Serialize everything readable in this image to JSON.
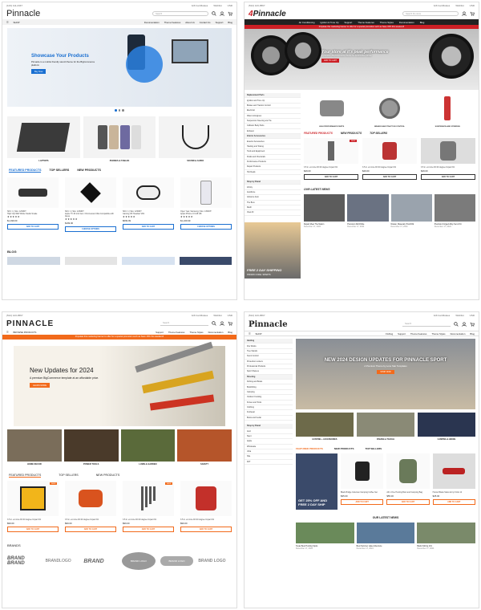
{
  "p1": {
    "util_left": "(123) 111-2347",
    "util_right": [
      "Gift Certificates",
      "Wishlist",
      "USD"
    ],
    "logo": "Pinnacle",
    "search_placeholder": "Search",
    "nav": {
      "shop": "SHOP",
      "links": [
        "Documentation",
        "Theme Features",
        "About Us",
        "Contact Us",
        "Support",
        "Blog"
      ]
    },
    "hero": {
      "title": "Showcase Your Products",
      "text": "Pinnacle is a mobile friendly stencil theme for the BigCommerce platform",
      "button": "Buy Now"
    },
    "cats": [
      "LAPTOPS",
      "PHONES & TABLES",
      "SOUND & AUDIO"
    ],
    "tabs": [
      "FEATURED PRODUCTS",
      "TOP SELLERS",
      "NEW PRODUCTS"
    ],
    "products": [
      {
        "meta": "SKU: 1 | Sku: 12S0NT",
        "name": "High Clip Wild Whole Studio Snake",
        "price": "$1,499.00",
        "btn": "ADD TO CART"
      },
      {
        "meta": "SKU: 1 | Sku: 12S0NT",
        "name": "Apple TV 4K 2nd Gen. Chromecast Ultra Compatible with Alexa",
        "price": "$199.00",
        "btn": "CHOOSE OPTIONS"
      },
      {
        "meta": "SKU: 1 | Sku: 12S0NT",
        "name": "Gaming VR Headset VR1",
        "price": "$699.99",
        "btn": "ADD TO CART"
      },
      {
        "meta": "Open Year, Samsung | Sku: 13S0NT",
        "name": "Apple iPhone 13 128 GB",
        "price": "$1,229.99",
        "btn": "CHOOSE OPTIONS"
      }
    ],
    "blog": "BLOG"
  },
  "p2": {
    "util_left": "(512) 123-0567",
    "util_right": [
      "Gift Certificates",
      "Wishlist",
      "USD"
    ],
    "logo": "Pinnacle",
    "search_placeholder": "Search the store",
    "nav": [
      "Air Conditioning",
      "Ignition & Tune Up",
      "Support",
      "Theme Features",
      "Theme Styles",
      "Documentation",
      "Blog"
    ],
    "redbar": "Populate this marketing banner to offer for a special promotion such as Save 15% this weekend!",
    "hero": {
      "title": "Your store at it's peak performance",
      "text": "A premium BigCommerce theme for Automotive stores",
      "button": "ADD TO CART"
    },
    "sidebar": [
      "Replacement Parts",
      "Ignition and Tune Up",
      "Brakes and Traction Control",
      "Electrical",
      "Filters & Engines",
      "Suspension Steering and Tie",
      "Collision Body Parts",
      "Exhaust",
      "Interior Accessories",
      "Exterior Accessories",
      "Hauling and Towing",
      "Tools and Equipment",
      "Fluids and Chemicals",
      "Performance Products",
      "Repair Products",
      "Hot Deals"
    ],
    "shopbrand": [
      "Shop by Brand",
      "Infinity",
      "AutoZone",
      "Advance Auto",
      "The Brux",
      "Merill",
      "View All"
    ],
    "cats": [
      "HIGH PERFORMANCE PARTS",
      "BRAKES AND TRACTION CONTROL",
      "SUSPENSION AND STEERING"
    ],
    "tabs": [
      "FEATURED PRODUCTS",
      "NEW PRODUCTS",
      "TOP SELLERS"
    ],
    "products": [
      {
        "name": "3.5 in. ext Line Fill 40 degree Impact Kit",
        "price": "$49.00",
        "btn": "ADD TO CART"
      },
      {
        "name": "3.5 in. ext Line Fill 40 degree Impact Kit",
        "price": "$49.00",
        "btn": "ADD TO CART"
      },
      {
        "name": "3.5 in. ext Line Fill 40 degree Impact Kit",
        "price": "$49.00",
        "btn": "ADD TO CART"
      }
    ],
    "promo": {
      "title": "FREE 2 DAY SHIPPING",
      "code": "PROMO CODE: SPARTS"
    },
    "news_title": "OUR LATEST NEWS",
    "news": [
      {
        "t": "Repair Meet The Nation",
        "d": "December 17, 2024"
      },
      {
        "t": "Premium 2024 Ride",
        "d": "December 17, 2024"
      },
      {
        "t": "Nissan, Maserati, Pirelli Rd",
        "d": "December 17, 2024"
      },
      {
        "t": "Precision Forged Alloy Set & Kit",
        "d": "December 17, 2024"
      }
    ]
  },
  "p3": {
    "util_left": "(512) 123-0567",
    "util_right": [
      "Gift Certificates",
      "Wishlist",
      "USD"
    ],
    "logo": "PINNACLE",
    "search_placeholder": "Search",
    "nav": {
      "shop": "BROWSE PRODUCTS",
      "links": [
        "Support",
        "Theme Features",
        "Theme Styles",
        "Documentation",
        "Blog"
      ]
    },
    "orangebar": "Populate this marketing banner to offer for a special promotion such as Save 15% this weekend!",
    "hero": {
      "title": "New Updates for 2024",
      "text": "A premium BigCommerce template at an affordable price.",
      "button": "LEARN MORE"
    },
    "cats": [
      "HOME DECOR",
      "POWER TOOLS",
      "LAWN & GARDEN",
      "SAFETY"
    ],
    "tabs": [
      "FEATURED PRODUCTS",
      "TOP SELLERS",
      "NEW PRODUCTS"
    ],
    "products": [
      {
        "name": "3.5 in. ext Line Fill 40 degree Impact Kit",
        "price": "$99.00",
        "btn": "ADD TO CART"
      },
      {
        "name": "3.5 in. ext Line Fill 40 degree Impact Kit",
        "price": "$99.00",
        "btn": "ADD TO CART"
      },
      {
        "name": "3.5 in. ext Line Fill 40 degree Impact Kit",
        "price": "$99.00",
        "btn": "ADD TO CART"
      },
      {
        "name": "3.5 in. ext Line Fill 40 degree Impact Kit",
        "price": "$99.00",
        "btn": "ADD TO CART"
      }
    ],
    "brands_title": "BRANDS",
    "brands": [
      "BRAND BRAND",
      "BRANDLOGO",
      "BRAND",
      "BRAND LOGO",
      "BRAND LOGO",
      "BRAND LOGO"
    ]
  },
  "p4": {
    "util_left": "(512) 123-0567",
    "util_right": [
      "Gift Certificates",
      "Wishlist",
      "USD"
    ],
    "logo": "Pinnacle",
    "search_placeholder": "Search",
    "nav": {
      "shop": "SHOP",
      "links": [
        "Fishing",
        "Support",
        "Theme Features",
        "Theme Styles",
        "Documentation",
        "Blog"
      ]
    },
    "sidebar": [
      "Hunting",
      "Fire Works",
      "Tree Stands",
      "Scent Control",
      "Protection Lockers",
      "Professional Products",
      "Sport Shelves"
    ],
    "sidebar2": [
      "Shooting",
      "Fishing and Boats",
      "Bowfishing",
      "Camping",
      "Outdoor Cooking",
      "Knives and Tools",
      "Clothing",
      "Footwear",
      "Boots and Cedar"
    ],
    "shopbrand": [
      "Shop by Brand",
      "Avid",
      "Stent",
      "Apple",
      "Wholesale",
      "Ultra",
      "Nite",
      "KFT"
    ],
    "hero": {
      "title": "NEW 2024 DESIGN UPDATES FOR PINNACLE SPORT",
      "text": "A Premium Theme by Lone Star Templates",
      "button": "SHOP NOW"
    },
    "cats": [
      "HUNTING + ACCESSORIES",
      "FISHING & TACKLE",
      "CAMPING & HIKING"
    ],
    "tabs": [
      "FEATURED PRODUCTS",
      "NEW PRODUCTS",
      "TOP SELLERS"
    ],
    "promo": {
      "title": "GET 25% OFF AND FREE 2 DAY SHIP"
    },
    "products": [
      {
        "name": "Black Bridge Coleman Camping Coffee Set",
        "price": "$35.00",
        "btn": "ADD TO CART"
      },
      {
        "name": "All in One Hunting Boot and Camping Bag",
        "price": "$55.00",
        "btn": "ADD TO CART"
      },
      {
        "name": "Hunter Blade Swiss Army Knife 12",
        "price": "$25.00",
        "btn": "ADD TO CART"
      }
    ],
    "news_title": "OUR LATEST NEWS",
    "news": [
      {
        "t": "Texas Best Hunting Spots",
        "d": "December 17, 2024"
      },
      {
        "t": "Best Summer Lake Adventure",
        "d": "December 17, 2024"
      },
      {
        "t": "Bank Fishing 101",
        "d": "December 17, 2024"
      }
    ]
  }
}
